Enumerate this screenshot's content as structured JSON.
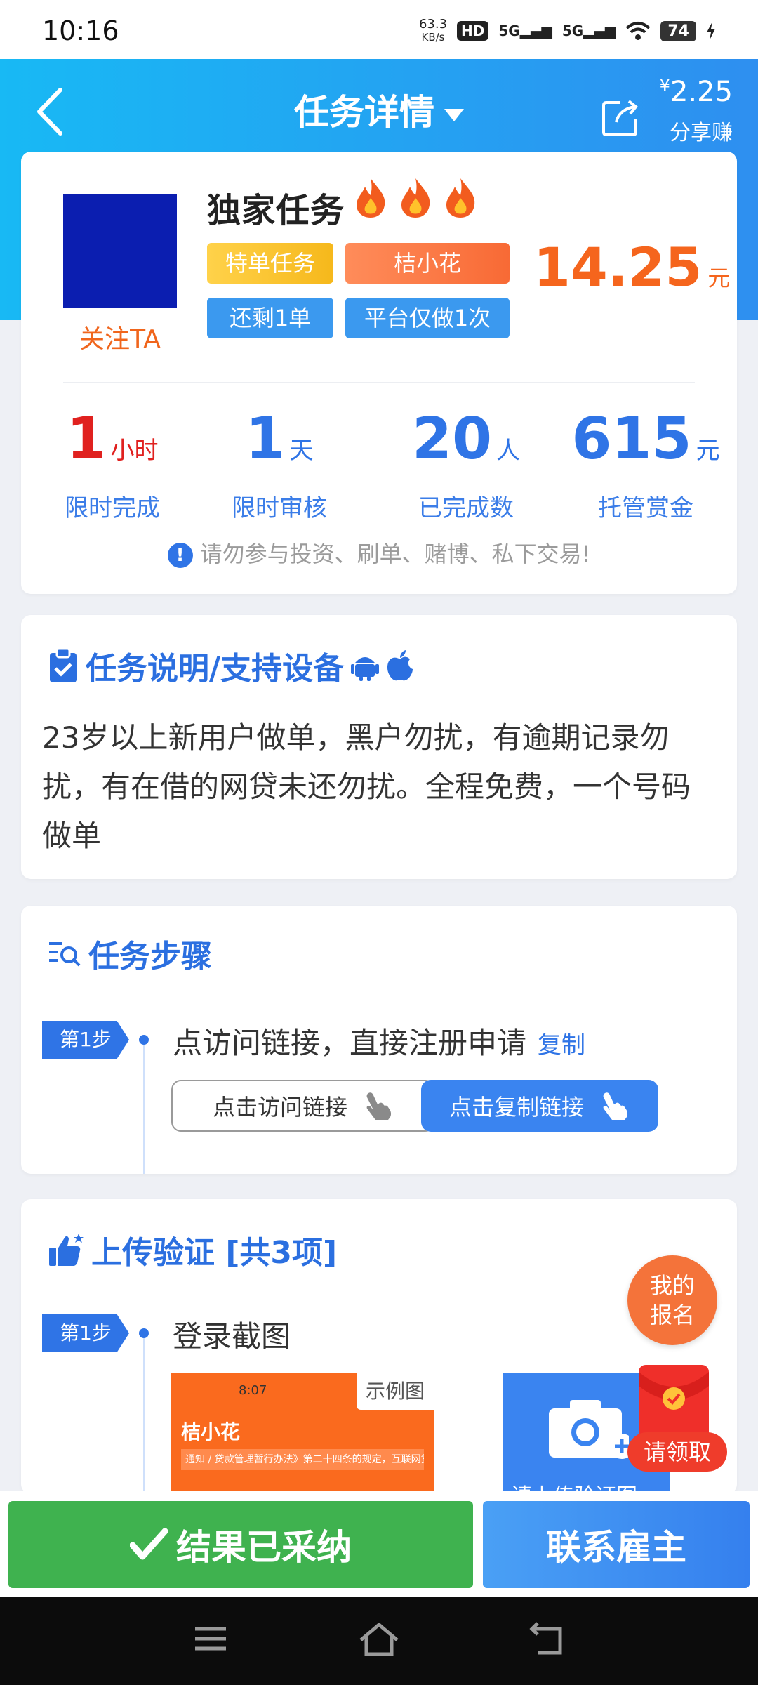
{
  "status_bar": {
    "time": "10:16",
    "net_speed_value": "63.3",
    "net_speed_unit": "KB/s",
    "hd_label": "HD",
    "signal1": "5G",
    "signal2": "5G",
    "battery": "74"
  },
  "header": {
    "title": "任务详情",
    "share_amount": "2.25",
    "share_currency": "¥",
    "share_label": "分享赚",
    "bg_color_start": "#18b9f4",
    "bg_color_end": "#2e8ff0"
  },
  "task": {
    "follow_label": "关注TA",
    "title": "独家任务",
    "flame_count": 3,
    "tags": {
      "special": "特单任务",
      "brand": "桔小花",
      "remaining": "还剩1单",
      "once": "平台仅做1次"
    },
    "price": "14.25",
    "price_unit": "元",
    "stats": [
      {
        "value": "1",
        "unit": "小时",
        "label": "限时完成"
      },
      {
        "value": "1",
        "unit": "天",
        "label": "限时审核"
      },
      {
        "value": "20",
        "unit": "人",
        "label": "已完成数"
      },
      {
        "value": "615",
        "unit": "元",
        "label": "托管赏金"
      }
    ],
    "warning": "请勿参与投资、刷单、赌博、私下交易!"
  },
  "description": {
    "title": "任务说明/支持设备",
    "text": "23岁以上新用户做单，黑户勿扰，有逾期记录勿扰，有在借的网贷未还勿扰。全程免费，一个号码做单"
  },
  "steps": {
    "title": "任务步骤",
    "items": [
      {
        "badge": "第1步",
        "text": "点访问链接，直接注册申请",
        "copy_label": "复制",
        "visit_button": "点击访问链接",
        "copy_button": "点击复制链接"
      }
    ]
  },
  "upload": {
    "title": "上传验证 [共3项]",
    "items": [
      {
        "badge": "第1步",
        "text": "登录截图",
        "sample_badge": "示例图",
        "sample_time": "8:07",
        "sample_brand": "桔小花",
        "sample_notice": "通知 / 贷款管理暂行办法》第二十四条的规定，互联网贷款只限",
        "upload_caption": "请上传验证图"
      }
    ]
  },
  "floating": {
    "signup_line1": "我的",
    "signup_line2": "报名",
    "redpacket_label": "请领取"
  },
  "bottom": {
    "adopted_button": "结果已采纳",
    "contact_button": "联系雇主",
    "adopted_color": "#3fb24f",
    "contact_color": "#3580ee"
  }
}
